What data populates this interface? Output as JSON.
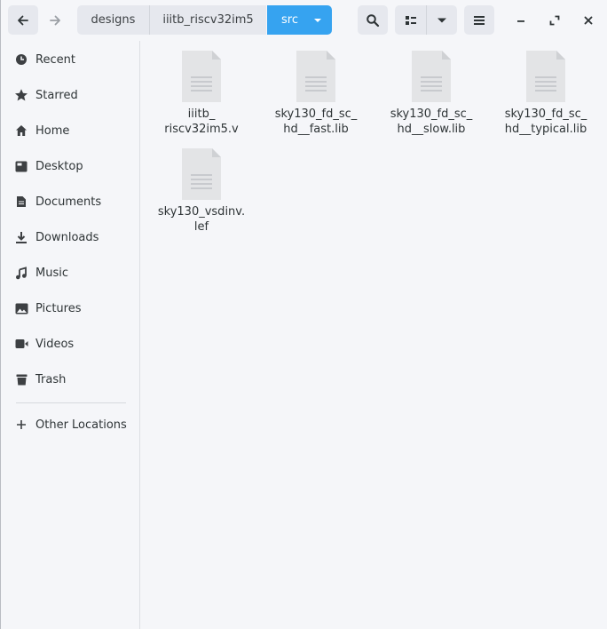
{
  "header": {
    "breadcrumbs": [
      "designs",
      "iiitb_riscv32im5",
      "src"
    ],
    "active_crumb": "src"
  },
  "sidebar": {
    "items": [
      {
        "label": "Recent",
        "icon": "clock-icon"
      },
      {
        "label": "Starred",
        "icon": "star-icon"
      },
      {
        "label": "Home",
        "icon": "home-icon"
      },
      {
        "label": "Desktop",
        "icon": "desktop-icon"
      },
      {
        "label": "Documents",
        "icon": "document-icon"
      },
      {
        "label": "Downloads",
        "icon": "download-icon"
      },
      {
        "label": "Music",
        "icon": "music-icon"
      },
      {
        "label": "Pictures",
        "icon": "picture-icon"
      },
      {
        "label": "Videos",
        "icon": "video-icon"
      },
      {
        "label": "Trash",
        "icon": "trash-icon"
      }
    ],
    "other_locations": {
      "label": "Other Locations",
      "icon": "plus-icon"
    }
  },
  "files": [
    {
      "line1": "iiitb_",
      "line2": "riscv32im5.v"
    },
    {
      "line1": "sky130_fd_sc_",
      "line2": "hd__fast.lib"
    },
    {
      "line1": "sky130_fd_sc_",
      "line2": "hd__slow.lib"
    },
    {
      "line1": "sky130_fd_sc_",
      "line2": "hd__typical.lib"
    },
    {
      "line1": "sky130_vsdinv.",
      "line2": "lef"
    }
  ],
  "colors": {
    "accent": "#36a3f0",
    "background": "#f5f6f9",
    "button": "#e6e8ee"
  }
}
